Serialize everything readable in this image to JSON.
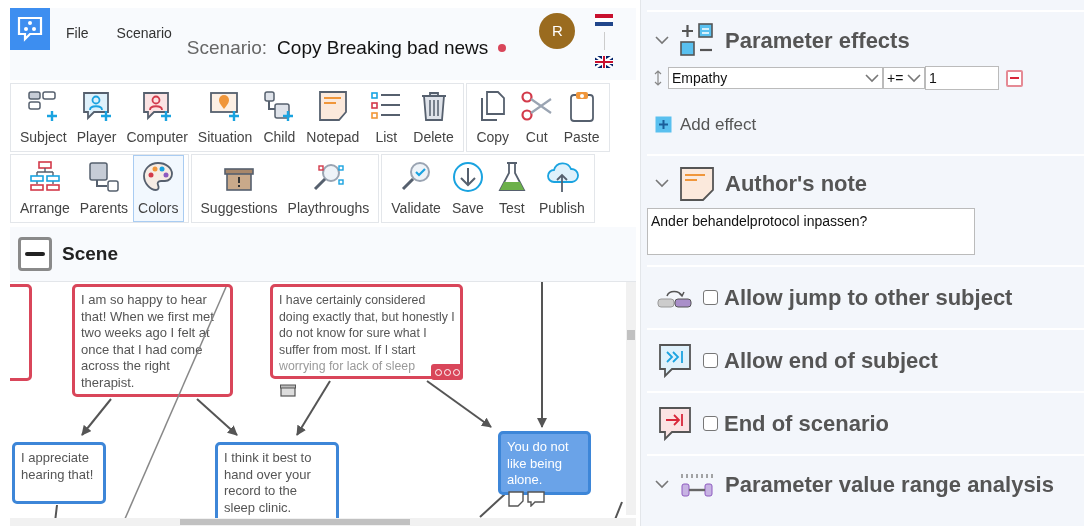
{
  "menu": [
    {
      "label": "File"
    },
    {
      "label": "Scenario"
    }
  ],
  "scenario": {
    "label": "Scenario:",
    "title": "Copy Breaking bad news",
    "unsaved": true
  },
  "user": {
    "initial": "R"
  },
  "toolbar": [
    [
      {
        "label": "Subject",
        "selected": false
      },
      {
        "label": "Player",
        "selected": false
      },
      {
        "label": "Computer",
        "selected": false
      },
      {
        "label": "Situation",
        "selected": false
      },
      {
        "label": "Child",
        "selected": false
      },
      {
        "label": "Notepad",
        "selected": false
      },
      {
        "label": "List",
        "selected": false
      },
      {
        "label": "Delete",
        "selected": false
      }
    ],
    [
      {
        "label": "Copy",
        "selected": false
      },
      {
        "label": "Cut",
        "selected": false
      },
      {
        "label": "Paste",
        "selected": false
      }
    ],
    [
      {
        "label": "Arrange",
        "selected": false
      },
      {
        "label": "Parents",
        "selected": false
      },
      {
        "label": "Colors",
        "selected": true
      }
    ],
    [
      {
        "label": "Suggestions",
        "selected": false
      },
      {
        "label": "Playthroughs",
        "selected": false
      }
    ],
    [
      {
        "label": "Validate",
        "selected": false
      },
      {
        "label": "Save",
        "selected": false
      },
      {
        "label": "Test",
        "selected": false
      },
      {
        "label": "Publish",
        "selected": false
      }
    ]
  ],
  "scene": {
    "title": "Scene",
    "nodes": [
      {
        "kind": "computer",
        "selected": false
      },
      {
        "kind": "computer",
        "text": "I am so happy to hear that! When we first met two weeks ago I felt at once that I had come across the right therapist.",
        "selected": false
      },
      {
        "kind": "computer",
        "text": "I have certainly considered doing exactly that, but honestly I do not know for sure what I suffer from most. If I start",
        "faded_text": "worrying for lack of sleep",
        "selected": false
      },
      {
        "kind": "player",
        "text": "I appreciate hearing that!",
        "selected": false
      },
      {
        "kind": "player",
        "text": "I think it best to hand over your record to the sleep clinic.",
        "selected": false
      },
      {
        "kind": "player",
        "text": "You do not like being alone.",
        "selected": true
      }
    ]
  },
  "parameter_effects": {
    "title": "Parameter effects",
    "effects": [
      {
        "parameter": "Empathy",
        "operator": "+=",
        "value": "1"
      }
    ],
    "add_label": "Add effect"
  },
  "authors_note": {
    "title": "Author's note",
    "text": "Ander behandelprotocol inpassen?"
  },
  "options": [
    {
      "label": "Allow jump to other subject",
      "checked": false
    },
    {
      "label": "Allow end of subject",
      "checked": false
    },
    {
      "label": "End of scenario",
      "checked": false
    }
  ],
  "range_analysis": {
    "title": "Parameter value range analysis"
  }
}
